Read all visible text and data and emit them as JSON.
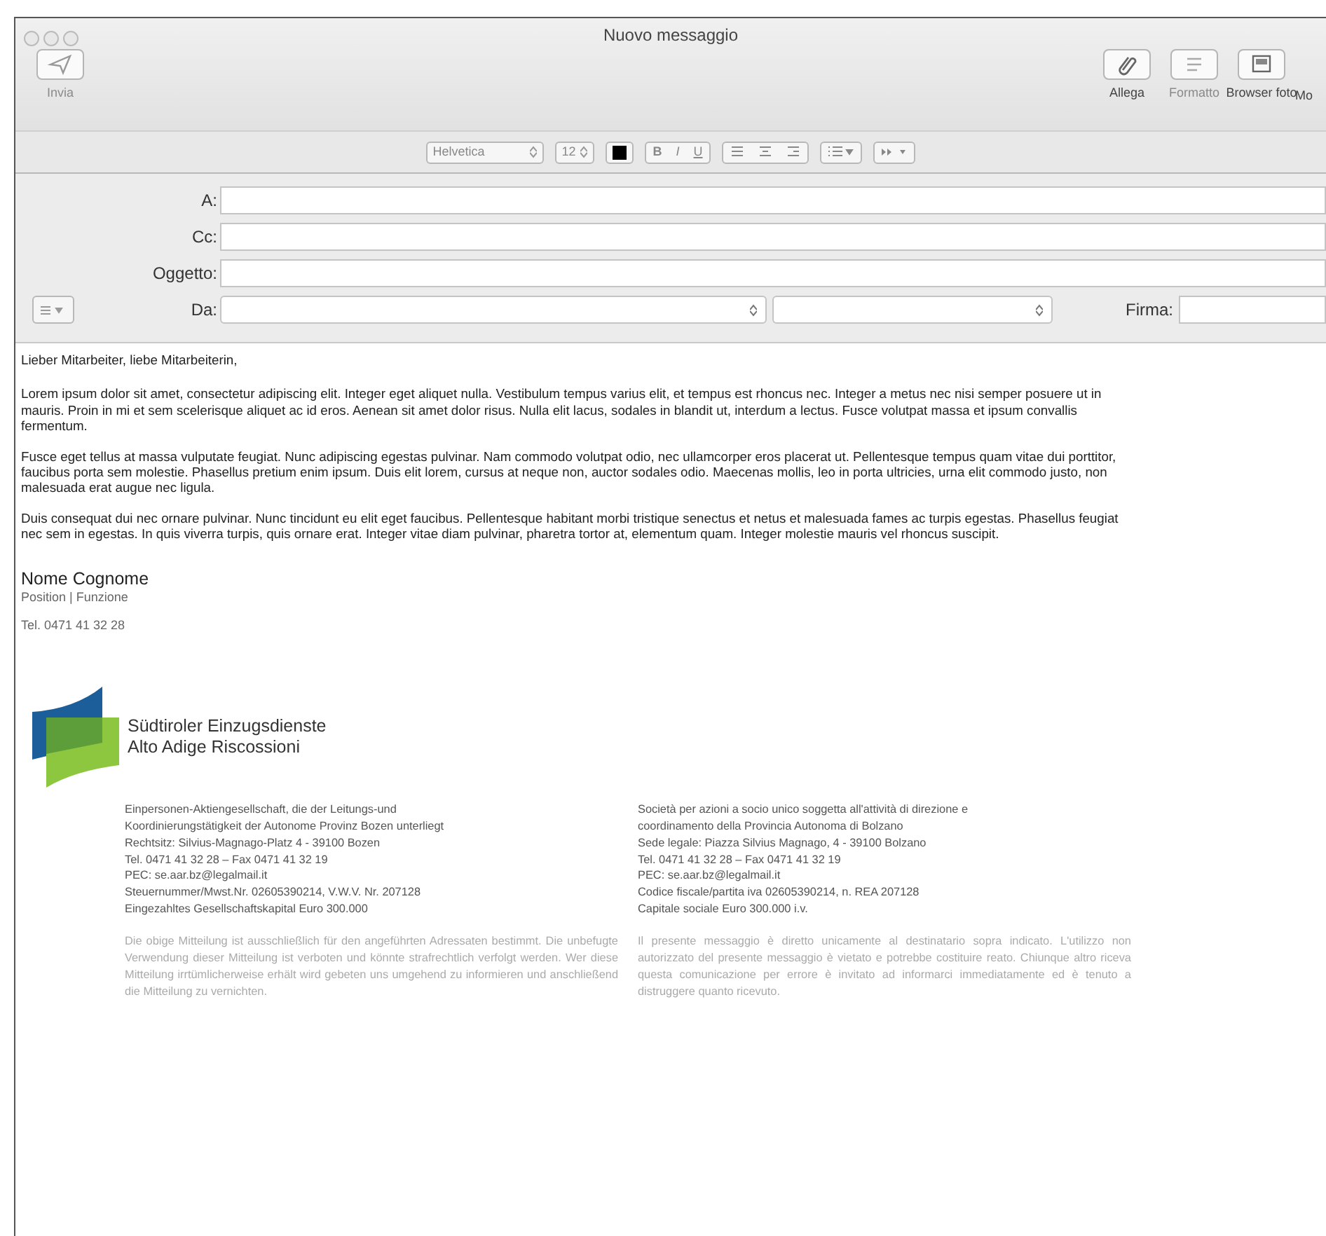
{
  "window": {
    "title": "Nuovo messaggio"
  },
  "toolbar": {
    "buttons": [
      {
        "kind": "send",
        "label": "Invia",
        "disabled": true
      },
      {
        "kind": "attach",
        "label": "Allega",
        "disabled": false
      },
      {
        "kind": "format",
        "label": "Formatto",
        "disabled": true
      },
      {
        "kind": "photo",
        "label": "Browser foto",
        "disabled": false
      },
      {
        "kind": "more",
        "label": "Mo",
        "disabled": false
      }
    ]
  },
  "format_bar": {
    "font": "Helvetica",
    "size": "12",
    "styles": [
      "B",
      "I",
      "U"
    ]
  },
  "header_fields": [
    {
      "kind": "text",
      "label": "A:"
    },
    {
      "kind": "text",
      "label": "Cc:"
    },
    {
      "kind": "text",
      "label": "Oggetto:"
    },
    {
      "kind": "from",
      "label": "Da:",
      "signature_label": "Firma:"
    }
  ],
  "body": {
    "greeting": "Lieber Mitarbeiter, liebe Mitarbeiterin,",
    "paragraphs": [
      "Lorem ipsum dolor sit amet, consectetur adipiscing elit. Integer eget aliquet nulla. Vestibulum tempus varius elit, et tempus est rhoncus nec. Integer a metus nec nisi semper posuere ut in mauris. Proin in mi et sem scelerisque aliquet ac id eros. Aenean sit amet dolor risus. Nulla elit lacus, sodales in blandit ut, interdum a lectus. Fusce volutpat massa et ipsum convallis fermentum.",
      "Fusce eget tellus at massa vulputate feugiat. Nunc adipiscing egestas pulvinar. Nam commodo volutpat odio, nec ullamcorper eros placerat ut. Pellentesque tempus quam vitae dui porttitor, faucibus porta sem molestie. Phasellus pretium enim ipsum. Duis elit lorem, cursus at neque non, auctor sodales odio. Maecenas mollis, leo in porta ultricies, urna elit commodo justo, non malesuada erat augue nec ligula.",
      "Duis consequat dui nec ornare pulvinar. Nunc tincidunt eu elit eget faucibus. Pellentesque habitant morbi tristique senectus et netus et malesuada fames ac turpis egestas. Phasellus feugiat nec sem in egestas. In quis viverra turpis, quis ornare erat. Integer vitae diam pulvinar, pharetra tortor at, elementum quam. Integer molestie mauris vel rhoncus suscipit."
    ],
    "signature": {
      "name": "Nome Cognome",
      "position": "Position | Funzione",
      "phone": "Tel. 0471 41 32 28"
    },
    "logo": {
      "lines": [
        "Südtiroler Einzugsdienste",
        "Alto Adige Riscossioni"
      ]
    },
    "footer_columns": [
      {
        "lines": [
          "Einpersonen-Aktiengesellschaft, die der Leitungs-und",
          "Koordinierungstätigkeit der Autonome Provinz Bozen unterliegt",
          "Rechtsitz: Silvius-Magnago-Platz 4 - 39100 Bozen",
          "Tel. 0471 41 32 28 – Fax 0471 41 32 19",
          "PEC: se.aar.bz@legalmail.it",
          "Steuernummer/Mwst.Nr. 02605390214, V.W.V. Nr. 207128",
          "Eingezahltes Gesellschaftskapital Euro 300.000"
        ],
        "disclaimer": "Die obige Mitteilung ist ausschließlich für den angeführten Adressaten bestimmt. Die unbefugte Verwendung dieser Mitteilung ist verboten und könnte strafrechtlich verfolgt werden. Wer diese Mitteilung irrtümlicherweise erhält wird gebeten uns umgehend zu informieren und anschließend die Mitteilung zu vernichten."
      },
      {
        "lines": [
          "Società per azioni a socio unico soggetta all'attività di direzione e",
          "coordinamento della Provincia Autonoma di Bolzano",
          "Sede legale: Piazza Silvius Magnago, 4 - 39100 Bolzano",
          "Tel. 0471 41 32 28 – Fax 0471 41 32 19",
          "PEC: se.aar.bz@legalmail.it",
          "Codice fiscale/partita iva 02605390214, n. REA 207128",
          "Capitale sociale Euro 300.000 i.v."
        ],
        "disclaimer": "Il presente messaggio è diretto unicamente al destinatario sopra indicato. L'utilizzo non autorizzato del presente messaggio è vietato e potrebbe costituire reato. Chiunque altro riceva questa comunicazione per errore è invitato ad informarci immediatamente ed è tenuto a distruggere quanto ricevuto."
      }
    ]
  }
}
